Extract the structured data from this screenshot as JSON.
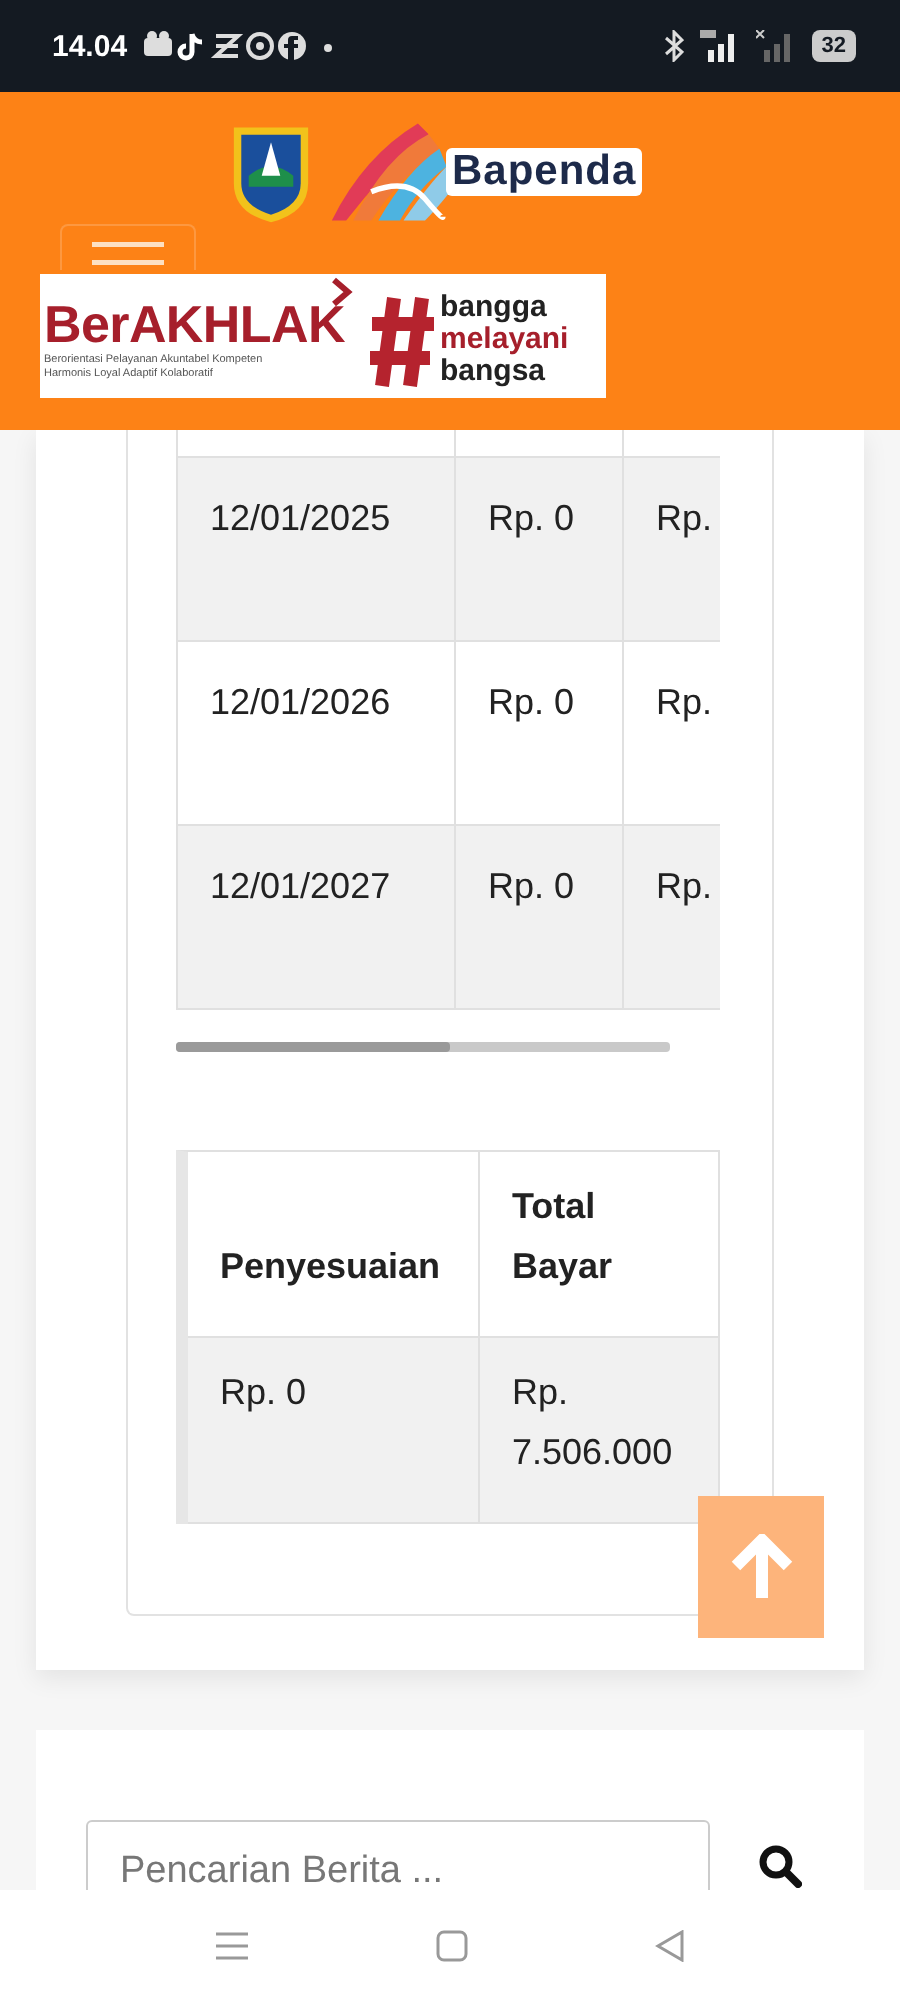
{
  "status_bar": {
    "time": "14.04",
    "battery": "32"
  },
  "header": {
    "logo_text": "Bapenda",
    "banner": {
      "title": "BerAKHLAK",
      "lines": [
        "Berorientasi Pelayanan Akuntabel Kompeten",
        "Harmonis Loyal Adaptif Kolaboratif"
      ],
      "slogan": [
        "bangga",
        "melayani",
        "bangsa"
      ]
    }
  },
  "table_1": {
    "rows": [
      {
        "cells": [
          "12/01/2025",
          "Rp. 0",
          "Rp."
        ]
      },
      {
        "cells": [
          "12/01/2026",
          "Rp. 0",
          "Rp."
        ]
      },
      {
        "cells": [
          "12/01/2027",
          "Rp. 0",
          "Rp."
        ]
      }
    ]
  },
  "table_2": {
    "columns": [
      "Penyesuaian",
      "Total Bayar"
    ],
    "rows": [
      {
        "cells": [
          "Rp. 0",
          "Rp. 7.506.000"
        ]
      }
    ]
  },
  "search": {
    "placeholder": "Pencarian Berita ..."
  }
}
